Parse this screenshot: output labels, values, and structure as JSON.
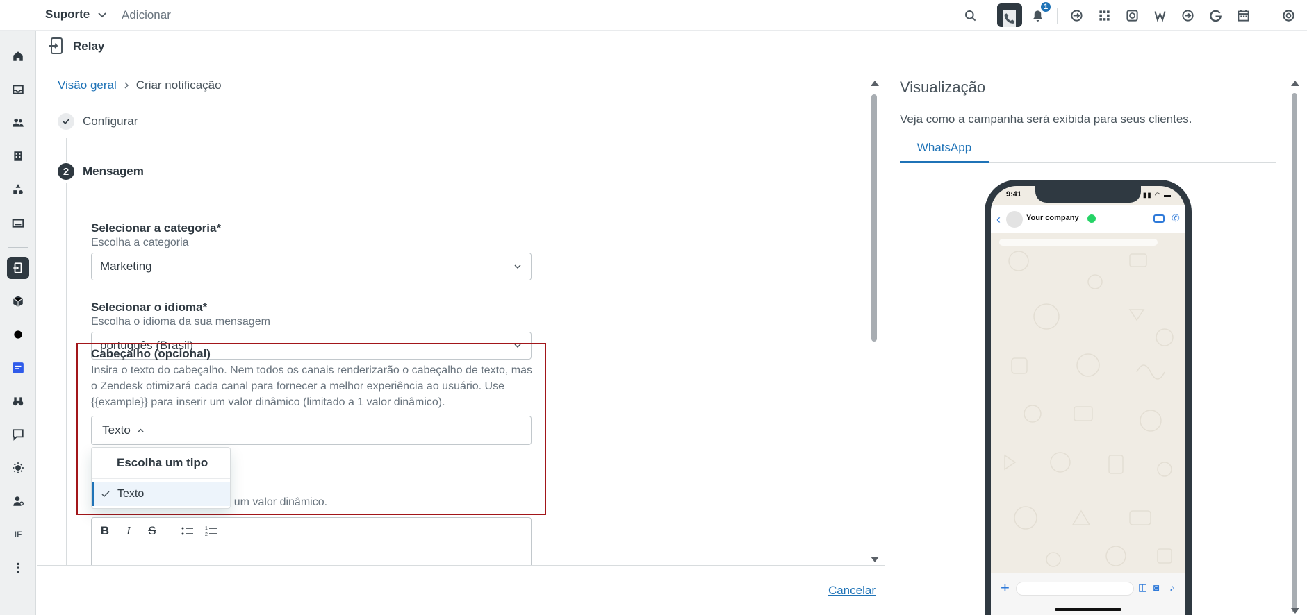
{
  "topbar": {
    "workspace": "Suporte",
    "add_label": "Adicionar",
    "notification_count": "1"
  },
  "app": {
    "name": "Relay"
  },
  "breadcrumb": {
    "root": "Visão geral",
    "current": "Criar notificação"
  },
  "steps": {
    "step1": {
      "label": "Configurar"
    },
    "step2": {
      "number": "2",
      "label": "Mensagem"
    }
  },
  "form": {
    "category": {
      "label": "Selecionar a categoria*",
      "hint": "Escolha a categoria",
      "value": "Marketing"
    },
    "language": {
      "label": "Selecionar o idioma*",
      "hint": "Escolha o idioma da sua mensagem",
      "value": "português (Brasil)"
    },
    "header": {
      "label": "Cabeçalho (opcional)",
      "hint": "Insira o texto do cabeçalho. Nem todos os canais renderizarão o cabeçalho de texto, mas o Zendesk otimizará cada canal para fornecer a melhor experiência ao usuário. Use {{example}} para inserir um valor dinâmico (limitado a 1 valor dinâmico).",
      "type_value": "Texto",
      "text_value": ""
    },
    "body_hint_partial": "r um valor dinâmico."
  },
  "dropdown": {
    "heading": "Escolha um tipo",
    "options": [
      {
        "label": "Texto",
        "selected": true
      }
    ]
  },
  "editor": {
    "toolbar": [
      "B",
      "I",
      "S",
      "bulleted-list",
      "numbered-list"
    ]
  },
  "footer": {
    "cancel_label": "Cancelar"
  },
  "preview": {
    "title": "Visualização",
    "description": "Veja como a campanha será exibida para seus clientes.",
    "tabs": [
      "WhatsApp"
    ],
    "phone": {
      "time": "9:41",
      "company": "Your company"
    }
  },
  "colors": {
    "accent": "#1f73b7",
    "highlight_border": "#a2161a",
    "whatsapp_green": "#25d366"
  }
}
